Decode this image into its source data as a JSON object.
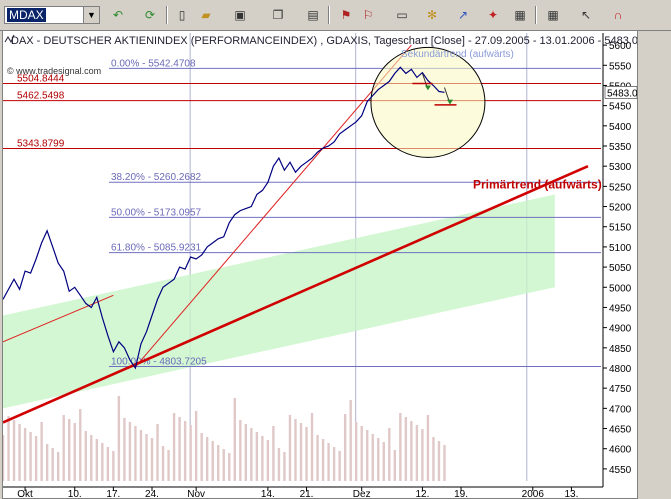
{
  "toolbar": {
    "symbol_value": "MDAX",
    "icons": [
      "back-icon",
      "refresh-icon",
      "new-icon",
      "open-icon",
      "save-icon",
      "copy-icon",
      "print-icon",
      "chart-type-icon",
      "window-icon",
      "draw-tools-icon",
      "indicator-icon",
      "trend-icon",
      "properties-icon",
      "grid-icon",
      "cursor-icon",
      "magnet-icon"
    ]
  },
  "chart_data": {
    "type": "line",
    "title": "DAX - DEUTSCHER AKTIENINDEX (PERFORMANCEINDEX) , GDAXIS, Tageschart [Close] - 27.09.2005 - 13.01.2006 - 5483.0",
    "watermark": "© www.tradesignal.com",
    "ylim": [
      4520,
      5630
    ],
    "y_ticks": [
      4550,
      4600,
      4650,
      4700,
      4750,
      4800,
      4850,
      4900,
      4950,
      5000,
      5050,
      5100,
      5150,
      5200,
      5250,
      5300,
      5350,
      5400,
      5450,
      5500,
      5550,
      5600
    ],
    "last_value_label": "5483.0",
    "x_tick_labels": [
      "Okt",
      "10.",
      "17.",
      "24.",
      "Nov",
      "14.",
      "21.",
      "Dez",
      "12.",
      "19.",
      "2006",
      "13."
    ],
    "x_tick_days": [
      4,
      13,
      20,
      27,
      35,
      48,
      55,
      65,
      76,
      83,
      96,
      103
    ],
    "day_range": [
      0,
      108
    ],
    "series": [
      {
        "values": [
          [
            0,
            4970
          ],
          [
            2,
            5020
          ],
          [
            3,
            4995
          ],
          [
            4,
            5040
          ],
          [
            5,
            5035
          ],
          [
            6,
            5070
          ],
          [
            7,
            5110
          ],
          [
            8,
            5140
          ],
          [
            9,
            5100
          ],
          [
            10,
            5060
          ],
          [
            11,
            5040
          ],
          [
            12,
            4990
          ],
          [
            13,
            5000
          ],
          [
            14,
            4980
          ],
          [
            15,
            4960
          ],
          [
            16,
            4950
          ],
          [
            17,
            4975
          ],
          [
            18,
            4925
          ],
          [
            19,
            4880
          ],
          [
            20,
            4840
          ],
          [
            21,
            4865
          ],
          [
            22,
            4850
          ],
          [
            23,
            4820
          ],
          [
            24,
            4800
          ],
          [
            25,
            4860
          ],
          [
            26,
            4890
          ],
          [
            27,
            4930
          ],
          [
            28,
            4970
          ],
          [
            29,
            5000
          ],
          [
            30,
            5010
          ],
          [
            31,
            5020
          ],
          [
            32,
            5050
          ],
          [
            33,
            5045
          ],
          [
            34,
            5075
          ],
          [
            35,
            5070
          ],
          [
            36,
            5080
          ],
          [
            37,
            5100
          ],
          [
            38,
            5110
          ],
          [
            39,
            5120
          ],
          [
            40,
            5125
          ],
          [
            41,
            5160
          ],
          [
            42,
            5180
          ],
          [
            43,
            5190
          ],
          [
            44,
            5195
          ],
          [
            45,
            5200
          ],
          [
            46,
            5230
          ],
          [
            47,
            5240
          ],
          [
            48,
            5260
          ],
          [
            49,
            5300
          ],
          [
            50,
            5320
          ],
          [
            51,
            5290
          ],
          [
            52,
            5310
          ],
          [
            53,
            5285
          ],
          [
            54,
            5300
          ],
          [
            55,
            5310
          ],
          [
            56,
            5320
          ],
          [
            57,
            5335
          ],
          [
            58,
            5345
          ],
          [
            59,
            5350
          ],
          [
            60,
            5360
          ],
          [
            61,
            5380
          ],
          [
            62,
            5390
          ],
          [
            63,
            5400
          ],
          [
            64,
            5410
          ],
          [
            65,
            5425
          ],
          [
            66,
            5460
          ],
          [
            67,
            5475
          ],
          [
            68,
            5490
          ],
          [
            69,
            5500
          ],
          [
            70,
            5510
          ],
          [
            71,
            5530
          ],
          [
            72,
            5545
          ],
          [
            73,
            5530
          ],
          [
            74,
            5540
          ],
          [
            75,
            5520
          ],
          [
            76,
            5532
          ],
          [
            77,
            5512
          ],
          [
            78,
            5500
          ],
          [
            79,
            5485
          ],
          [
            80,
            5483
          ]
        ]
      }
    ],
    "fibonacci": [
      {
        "label": "0.00% - 5542.4708",
        "value": 5542.4708
      },
      {
        "label": "38.20% - 5260.2682",
        "value": 5260.2682
      },
      {
        "label": "50.00% - 5173.0957",
        "value": 5173.0957
      },
      {
        "label": "61.80% - 5085.9231",
        "value": 5085.9231
      },
      {
        "label": "100.00% - 4803.7205",
        "value": 4803.7205
      }
    ],
    "levels": [
      {
        "label": "5504.8444",
        "value": 5504.8444
      },
      {
        "label": "5462.5498",
        "value": 5462.5498
      },
      {
        "label": "5343.8799",
        "value": 5343.8799
      }
    ],
    "annotations": {
      "primary_trend": "Primärtrend (aufwärts)",
      "secondary_trend": "Sekundärtrend (aufwärts)"
    },
    "colors": {
      "price": "#000080",
      "primary_trend": "#d00000",
      "level": "#c00000",
      "fib": "#7070c0",
      "channel": "#c8f5c8",
      "circle": "#fafac0",
      "volume": "#e0c8c8"
    }
  }
}
